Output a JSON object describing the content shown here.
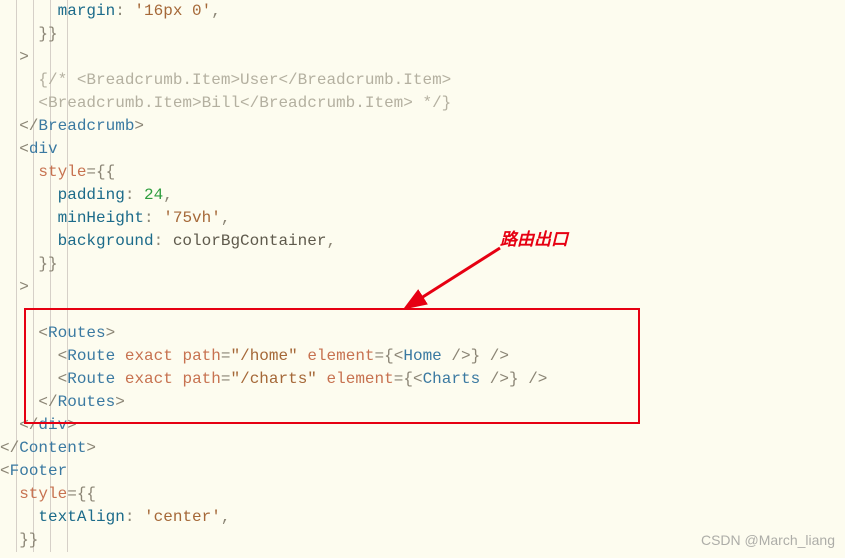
{
  "annotation_label": "路由出口",
  "watermark": "CSDN @March_liang",
  "code": {
    "lines": [
      [
        [
          "p",
          "      "
        ],
        [
          "kwprop",
          "margin"
        ],
        [
          "punct",
          ": "
        ],
        [
          "str",
          "'16px 0'"
        ],
        [
          "punct",
          ","
        ]
      ],
      [
        [
          "p",
          "    "
        ],
        [
          "punct",
          "}}"
        ]
      ],
      [
        [
          "p",
          "  "
        ],
        [
          "punct",
          ">"
        ]
      ],
      [
        [
          "p",
          "    "
        ],
        [
          "comment",
          "{/* <Breadcrumb.Item>User</Breadcrumb.Item>"
        ]
      ],
      [
        [
          "p",
          "    "
        ],
        [
          "comment",
          "<Breadcrumb.Item>Bill</Breadcrumb.Item> */}"
        ]
      ],
      [
        [
          "p",
          "  "
        ],
        [
          "punct",
          "</"
        ],
        [
          "tag",
          "Breadcrumb"
        ],
        [
          "punct",
          ">"
        ]
      ],
      [
        [
          "p",
          "  "
        ],
        [
          "punct",
          "<"
        ],
        [
          "tag",
          "div"
        ]
      ],
      [
        [
          "p",
          "    "
        ],
        [
          "attr",
          "style"
        ],
        [
          "punct",
          "="
        ],
        [
          "punct",
          "{{"
        ]
      ],
      [
        [
          "p",
          "      "
        ],
        [
          "kwprop",
          "padding"
        ],
        [
          "punct",
          ": "
        ],
        [
          "num",
          "24"
        ],
        [
          "punct",
          ","
        ]
      ],
      [
        [
          "p",
          "      "
        ],
        [
          "kwprop",
          "minHeight"
        ],
        [
          "punct",
          ": "
        ],
        [
          "str",
          "'75vh'"
        ],
        [
          "punct",
          ","
        ]
      ],
      [
        [
          "p",
          "      "
        ],
        [
          "kwprop",
          "background"
        ],
        [
          "punct",
          ": "
        ],
        [
          "plain",
          "colorBgContainer"
        ],
        [
          "punct",
          ","
        ]
      ],
      [
        [
          "p",
          "    "
        ],
        [
          "punct",
          "}}"
        ]
      ],
      [
        [
          "p",
          "  "
        ],
        [
          "punct",
          ">"
        ]
      ],
      [
        [
          "p",
          ""
        ]
      ],
      [
        [
          "p",
          "    "
        ],
        [
          "punct",
          "<"
        ],
        [
          "tag",
          "Routes"
        ],
        [
          "punct",
          ">"
        ]
      ],
      [
        [
          "p",
          "      "
        ],
        [
          "punct",
          "<"
        ],
        [
          "tag",
          "Route"
        ],
        [
          "p",
          " "
        ],
        [
          "attr",
          "exact"
        ],
        [
          "p",
          " "
        ],
        [
          "attr",
          "path"
        ],
        [
          "punct",
          "="
        ],
        [
          "str",
          "\"/home\""
        ],
        [
          "p",
          " "
        ],
        [
          "attr",
          "element"
        ],
        [
          "punct",
          "="
        ],
        [
          "punct",
          "{"
        ],
        [
          "punct",
          "<"
        ],
        [
          "tag",
          "Home"
        ],
        [
          "p",
          " "
        ],
        [
          "punct",
          "/>"
        ],
        [
          "punct",
          "}"
        ],
        [
          "p",
          " "
        ],
        [
          "punct",
          "/>"
        ]
      ],
      [
        [
          "p",
          "      "
        ],
        [
          "punct",
          "<"
        ],
        [
          "tag",
          "Route"
        ],
        [
          "p",
          " "
        ],
        [
          "attr",
          "exact"
        ],
        [
          "p",
          " "
        ],
        [
          "attr",
          "path"
        ],
        [
          "punct",
          "="
        ],
        [
          "str",
          "\"/charts\""
        ],
        [
          "p",
          " "
        ],
        [
          "attr",
          "element"
        ],
        [
          "punct",
          "="
        ],
        [
          "punct",
          "{"
        ],
        [
          "punct",
          "<"
        ],
        [
          "tag",
          "Charts"
        ],
        [
          "p",
          " "
        ],
        [
          "punct",
          "/>"
        ],
        [
          "punct",
          "}"
        ],
        [
          "p",
          " "
        ],
        [
          "punct",
          "/>"
        ]
      ],
      [
        [
          "p",
          "    "
        ],
        [
          "punct",
          "</"
        ],
        [
          "tag",
          "Routes"
        ],
        [
          "punct",
          ">"
        ]
      ],
      [
        [
          "p",
          "  "
        ],
        [
          "punct",
          "</"
        ],
        [
          "tag",
          "div"
        ],
        [
          "punct",
          ">"
        ]
      ],
      [
        [
          "punct",
          "</"
        ],
        [
          "tag",
          "Content"
        ],
        [
          "punct",
          ">"
        ]
      ],
      [
        [
          "punct",
          "<"
        ],
        [
          "tag",
          "Footer"
        ]
      ],
      [
        [
          "p",
          "  "
        ],
        [
          "attr",
          "style"
        ],
        [
          "punct",
          "="
        ],
        [
          "punct",
          "{{"
        ]
      ],
      [
        [
          "p",
          "    "
        ],
        [
          "kwprop",
          "textAlign"
        ],
        [
          "punct",
          ": "
        ],
        [
          "str",
          "'center'"
        ],
        [
          "punct",
          ","
        ]
      ],
      [
        [
          "p",
          "  "
        ],
        [
          "punct",
          "}}"
        ]
      ]
    ]
  }
}
